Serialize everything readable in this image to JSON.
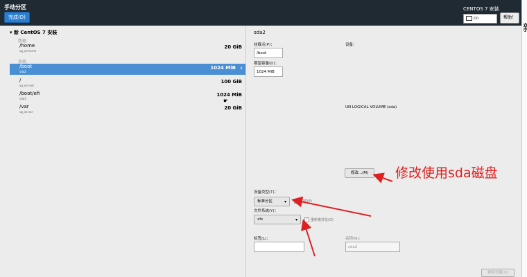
{
  "header": {
    "title": "手动分区",
    "done_label": "完成(D)",
    "install_title": "CENTOS 7 安装",
    "keyboard_layout": "cn",
    "help_label": "帮助！"
  },
  "edge_char": "新",
  "left": {
    "section_title": "新 CentOS 7 安装",
    "groups": [
      {
        "label": "数据"
      },
      {
        "label": "系统"
      }
    ],
    "partitions": [
      {
        "name": "/home",
        "sub": "vg_os-home",
        "size": "20 GiB"
      },
      {
        "name": "/boot",
        "sub": "sda2",
        "size": "1024 MiB"
      },
      {
        "name": "/",
        "sub": "vg_os-root",
        "size": "100 GiB"
      },
      {
        "name": "/boot/efi",
        "sub": "sda1",
        "size": "1024 MiB"
      },
      {
        "name": "/var",
        "sub": "vg_os-var",
        "size": "20 GiB"
      }
    ]
  },
  "right": {
    "title": "sda2",
    "mount_label": "挂载点(P)：",
    "mount_value": "/boot",
    "capacity_label": "期望容量(D)：",
    "capacity_value": "1024 MiB",
    "device_label": "设备：",
    "volume_text": "UN LOGICAL VOLUME (sda)",
    "modify_label": "修改...(M)",
    "device_type_label": "设备类型(T)：",
    "device_type_value": "标准分区",
    "encrypt_label": "加密(E)",
    "fs_label": "文件系统(Y)：",
    "fs_value": "xfs",
    "reformat_label": "重新格式化(O)",
    "tag_label": "标签(L)：",
    "tag_value": "",
    "name_label": "名称(N)：",
    "name_value": "sda2",
    "update_label": "更新设置(U)"
  },
  "annotation": "修改使用sda磁盘",
  "colors": {
    "header": "#1f2a33",
    "accent": "#2a7ed2",
    "selected": "#4a8fd4",
    "arrow": "#e02020"
  }
}
